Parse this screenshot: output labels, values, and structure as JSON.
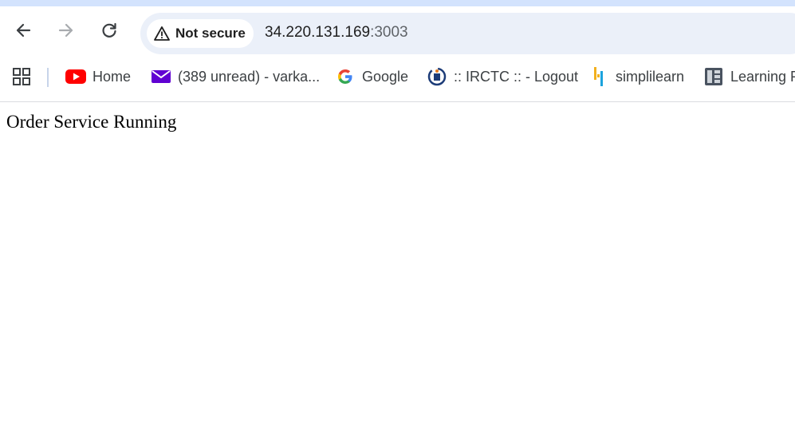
{
  "toolbar": {
    "security_label": "Not secure",
    "url_host": "34.220.131.169",
    "url_port": ":3003"
  },
  "bookmarks": {
    "items": [
      {
        "label": "Home",
        "icon": "youtube-icon"
      },
      {
        "label": "(389 unread) - varka...",
        "icon": "mail-icon"
      },
      {
        "label": "Google",
        "icon": "google-icon"
      },
      {
        "label": ":: IRCTC :: - Logout",
        "icon": "irctc-icon"
      },
      {
        "label": "simplilearn",
        "icon": "simplilearn-icon"
      },
      {
        "label": "Learning P",
        "icon": "learning-icon"
      }
    ]
  },
  "page": {
    "body_text": "Order Service Running"
  },
  "colors": {
    "top_strip": "#d3e3fd",
    "omnibox_bg": "#ebf0f9",
    "youtube_red": "#ff0000",
    "mail_purple": "#6001d2"
  }
}
